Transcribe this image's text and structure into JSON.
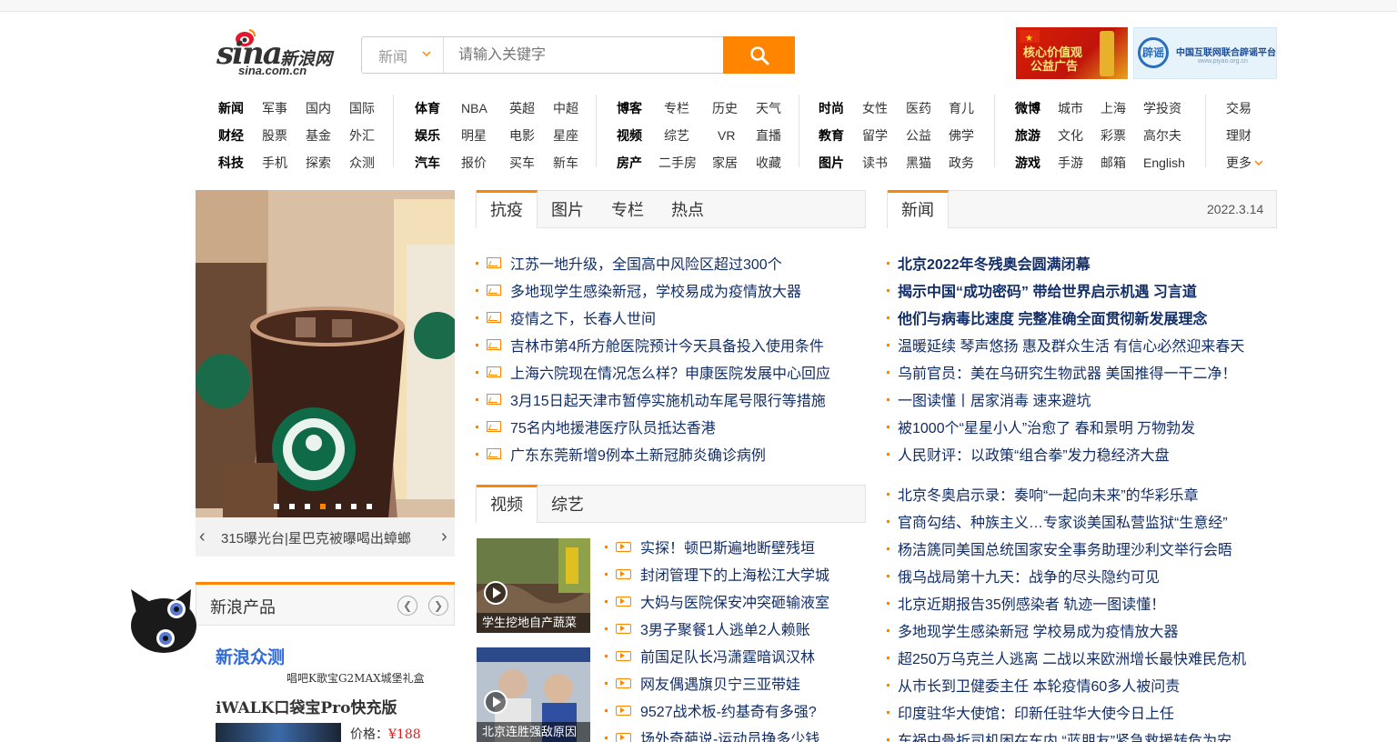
{
  "logo": {
    "brand": "sina",
    "cn": "新浪网",
    "domain": "sina.com.cn"
  },
  "search": {
    "type_label": "新闻",
    "placeholder": "请输入关键字"
  },
  "ads": {
    "ad1_line1": "核心价值观",
    "ad1_line2": "公益广告",
    "ad2_mark": "辟谣",
    "ad2_title": "中国互联网联合辟谣平台",
    "ad2_url": "www.piyao.org.cn"
  },
  "nav": {
    "groups": [
      {
        "rows": [
          [
            "新闻",
            "军事",
            "国内",
            "国际"
          ],
          [
            "财经",
            "股票",
            "基金",
            "外汇"
          ],
          [
            "科技",
            "手机",
            "探索",
            "众测"
          ]
        ]
      },
      {
        "rows": [
          [
            "体育",
            "NBA",
            "英超",
            "中超"
          ],
          [
            "娱乐",
            "明星",
            "电影",
            "星座"
          ],
          [
            "汽车",
            "报价",
            "买车",
            "新车"
          ]
        ]
      },
      {
        "rows": [
          [
            "博客",
            "专栏",
            "历史",
            "天气"
          ],
          [
            "视频",
            "综艺",
            "VR",
            "直播"
          ],
          [
            "房产",
            "二手房",
            "家居",
            "收藏"
          ]
        ]
      },
      {
        "rows": [
          [
            "时尚",
            "女性",
            "医药",
            "育儿"
          ],
          [
            "教育",
            "留学",
            "公益",
            "佛学"
          ],
          [
            "图片",
            "读书",
            "黑猫",
            "政务"
          ]
        ]
      },
      {
        "rows": [
          [
            "微博",
            "城市",
            "上海",
            "学投资"
          ],
          [
            "旅游",
            "文化",
            "彩票",
            "高尔夫"
          ],
          [
            "游戏",
            "手游",
            "邮箱",
            "English"
          ]
        ]
      }
    ],
    "extra": [
      "交易",
      "理财",
      "更多"
    ]
  },
  "slider": {
    "caption": "315曝光台|星巴克被曝喝出蟑螂",
    "dots": 7,
    "active_dot": 3
  },
  "epidemic": {
    "tabs": [
      "抗疫",
      "图片",
      "专栏",
      "热点"
    ],
    "items": [
      "江苏一地升级，全国高中风险区超过300个",
      "多地现学生感染新冠，学校易成为疫情放大器",
      "疫情之下，长春人世间",
      "吉林市第4所方舱医院预计今天具备投入使用条件",
      "上海六院现在情况怎么样？申康医院发展中心回应",
      "3月15日起天津市暂停实施机动车尾号限行等措施",
      "75名内地援港医疗队员抵达香港",
      "广东东莞新增9例本土新冠肺炎确诊病例"
    ]
  },
  "video": {
    "tabs": [
      "视频",
      "综艺"
    ],
    "thumbs": [
      "学生挖地自产蔬菜",
      "北京连胜强敌原因"
    ],
    "items": [
      "实探！顿巴斯遍地断壁残垣",
      "封闭管理下的上海松江大学城",
      "大妈与医院保安冲突砸输液室",
      "3男子聚餐1人逃单2人赖账",
      "前国足队长冯潇霆暗讽汉林",
      "网友偶遇旗贝宁三亚带娃",
      "9527战术板-约基奇有多强?",
      "场外奇葩说-运动员挣多少钱"
    ]
  },
  "news": {
    "tab": "新闻",
    "date": "2022.3.14",
    "bold_items": [
      "北京2022年冬残奥会圆满闭幕",
      "揭示中国“成功密码” 带给世界启示机遇 习言道",
      "他们与病毒比速度 完整准确全面贯彻新发展理念"
    ],
    "items_a": [
      "温暖延续 琴声悠扬 惠及群众生活 有信心必然迎来春天",
      "乌前官员：美在乌研究生物武器 美国推得一干二净！",
      "一图读懂丨居家消毒 速来避坑",
      "被1000个“星星小人”治愈了 春和景明 万物勃发",
      "人民财评：以政策“组合拳”发力稳经济大盘"
    ],
    "items_b": [
      "北京冬奥启示录：奏响“一起向未来”的华彩乐章",
      "官商勾结、种族主义…专家谈美国私营监狱“生意经”",
      "杨洁篪同美国总统国家安全事务助理沙利文举行会晤",
      "俄乌战局第十九天：战争的尽头隐约可见",
      "北京近期报告35例感染者 轨迹一图读懂！",
      "多地现学生感染新冠 学校易成为疫情放大器",
      "超250万乌克兰人逃离 二战以来欧洲增长最快难民危机",
      "从市长到卫健委主任 本轮疫情60多人被问责",
      "印度驻华大使馆：印新任驻华大使今日上任",
      "车祸中骨折司机困在车内 “蓝朋友”紧急救援转危为安"
    ]
  },
  "products": {
    "title": "新浪产品",
    "brand": "新浪众测",
    "sub": "唱吧K歌宝G2MAX城堡礼盒",
    "name": "iWALK口袋宝Pro快充版",
    "price_label": "价格：",
    "price": "¥188"
  },
  "colors": {
    "accent": "#ff8400",
    "link": "#122e67"
  }
}
